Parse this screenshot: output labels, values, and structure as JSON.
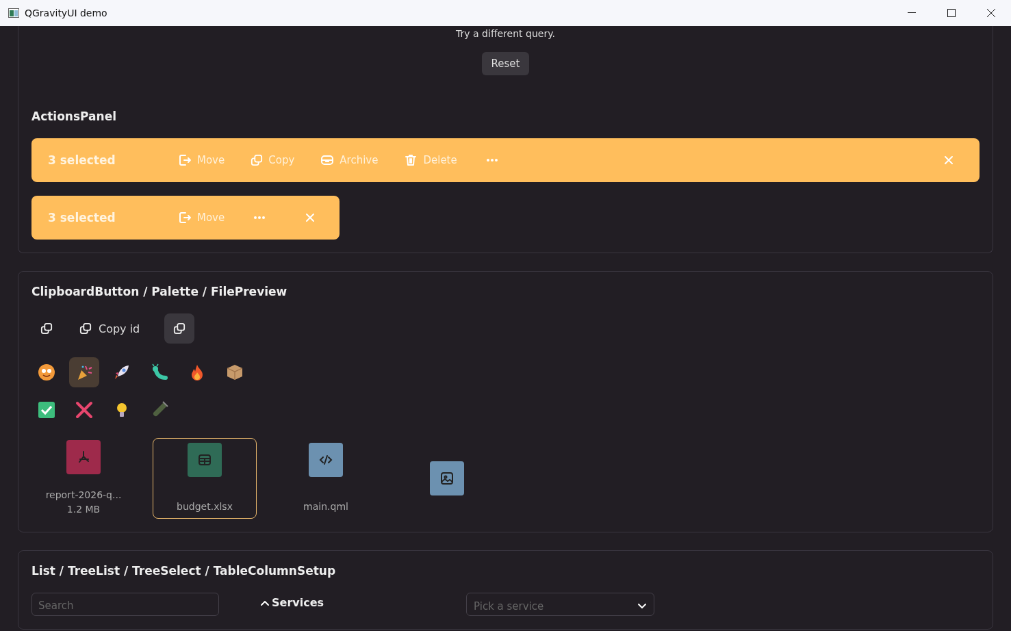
{
  "window": {
    "title": "QGravityUI demo"
  },
  "empty_state": {
    "message": "Try a different query.",
    "button": "Reset"
  },
  "actions_panel": {
    "title": "ActionsPanel",
    "bars": [
      {
        "count": "3 selected",
        "actions": [
          {
            "kind": "move",
            "label": "Move"
          },
          {
            "kind": "copy",
            "label": "Copy"
          },
          {
            "kind": "archive",
            "label": "Archive"
          },
          {
            "kind": "delete",
            "label": "Delete"
          }
        ],
        "wide": true
      },
      {
        "count": "3 selected",
        "actions": [
          {
            "kind": "move",
            "label": "Move"
          }
        ],
        "wide": false
      }
    ]
  },
  "clipboard_panel": {
    "title": "ClipboardButton / Palette / FilePreview",
    "clipboard_buttons": [
      {
        "kind": "flat"
      },
      {
        "kind": "flat",
        "label": "Copy id"
      },
      {
        "kind": "filled"
      }
    ],
    "palette_rows": [
      [
        {
          "kind": "smiley",
          "selected": false
        },
        {
          "kind": "party",
          "selected": true
        },
        {
          "kind": "rocket",
          "selected": false
        },
        {
          "kind": "caterpillar",
          "selected": false
        },
        {
          "kind": "fire",
          "selected": false
        },
        {
          "kind": "package",
          "selected": false
        }
      ],
      [
        {
          "kind": "check",
          "selected": false
        },
        {
          "kind": "cross",
          "selected": false
        },
        {
          "kind": "bulb",
          "selected": false
        },
        {
          "kind": "tube",
          "selected": false
        }
      ]
    ],
    "files": [
      {
        "kind": "pdf",
        "name": "report-2026-q...",
        "size": "1.2 MB",
        "selected": false
      },
      {
        "kind": "sheet",
        "name": "budget.xlsx",
        "selected": true
      },
      {
        "kind": "code",
        "name": "main.qml",
        "selected": false
      },
      {
        "kind": "image",
        "selected": false
      }
    ]
  },
  "list_panel": {
    "title": "List / TreeList / TreeSelect / TableColumnSetup",
    "search": {
      "placeholder": "Search"
    },
    "tree": {
      "label": "Services",
      "expanded": true
    },
    "select": {
      "placeholder": "Pick a service"
    }
  }
}
